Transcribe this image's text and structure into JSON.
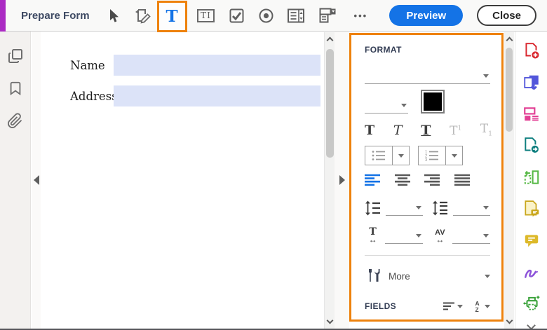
{
  "toolbar": {
    "title": "Prepare Form",
    "text_field_glyph": "T",
    "text_frame_glyph": "TI",
    "ellipsis": "•••",
    "preview_label": "Preview",
    "close_label": "Close"
  },
  "document": {
    "fields": [
      {
        "label": "Name"
      },
      {
        "label": "Address"
      }
    ]
  },
  "format_panel": {
    "title": "FORMAT",
    "font_family_value": "",
    "font_size_value": "",
    "text_color": "#000000",
    "bold_glyph": "T",
    "italic_glyph": "T",
    "underline_glyph": "T",
    "sup_base": "T",
    "sup_digit": "1",
    "sub_base": "T",
    "sub_digit": "1",
    "numbered_list_digits": {
      "d1": "1",
      "d2": "2",
      "d3": "3"
    },
    "char_width_glyph": "T",
    "kerning_glyph": "AV",
    "h_arrow": "↔",
    "more_label": "More",
    "fields_title": "FIELDS",
    "sort_az": {
      "a": "A",
      "z": "Z"
    }
  },
  "colors": {
    "annotation_orange": "#EE820D",
    "active_blue": "#1473E6",
    "brand_purple": "#AB2BC3",
    "field_fill": "#DCE3F8"
  }
}
